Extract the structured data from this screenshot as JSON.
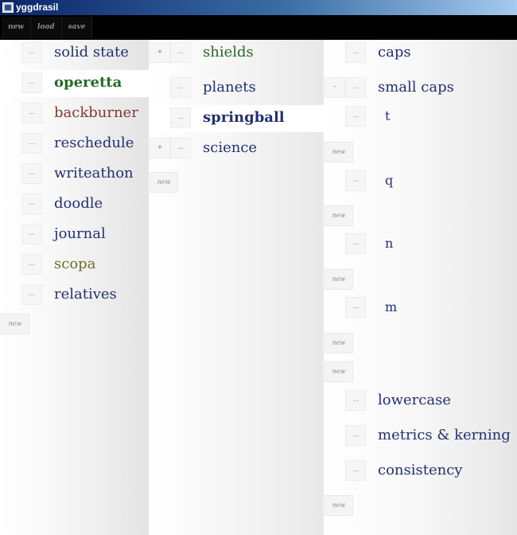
{
  "window": {
    "title": "yggdrasil"
  },
  "toolbar": {
    "new_label": "new",
    "load_label": "load",
    "save_label": "save"
  },
  "colors": {
    "default_text": "#25306d",
    "green_text": "#2a6a2a",
    "brown_text": "#7a3b2e",
    "olive_text": "#6e6e2c",
    "title_gradient_start": "#0a246a",
    "title_gradient_end": "#a6caf0"
  },
  "column1": {
    "items": [
      {
        "label": "solid state",
        "more": "...",
        "color": "#25306d"
      },
      {
        "label": "operetta",
        "more": "...",
        "color": "#2a6a2a"
      },
      {
        "label": "backburner",
        "more": "...",
        "color": "#7a3b2e"
      },
      {
        "label": "reschedule",
        "more": "...",
        "color": "#25306d"
      },
      {
        "label": "writeathon",
        "more": "...",
        "color": "#25306d"
      },
      {
        "label": "doodle",
        "more": "...",
        "color": "#25306d"
      },
      {
        "label": "journal",
        "more": "...",
        "color": "#25306d"
      },
      {
        "label": "scopa",
        "more": "...",
        "color": "#6e6e2c"
      },
      {
        "label": "relatives",
        "more": "...",
        "color": "#25306d"
      }
    ],
    "new_label": "new"
  },
  "column2": {
    "items": [
      {
        "label": "shields",
        "more": "...",
        "toggle": "+",
        "color": "#2a6a2a"
      },
      {
        "label": "planets",
        "more": "...",
        "toggle": "",
        "color": "#25306d"
      },
      {
        "label": "springball",
        "more": "...",
        "toggle": "",
        "color": "#25306d"
      },
      {
        "label": "science",
        "more": "...",
        "toggle": "+",
        "color": "#25306d"
      }
    ],
    "new_label": "new"
  },
  "column3": {
    "items": [
      {
        "label": "caps",
        "more": "...",
        "toggle": ""
      },
      {
        "label": "small caps",
        "more": "...",
        "toggle": "-"
      },
      {
        "label": "t",
        "more": "..."
      },
      {
        "label": "new"
      },
      {
        "label": "q",
        "more": "..."
      },
      {
        "label": "new"
      },
      {
        "label": "n",
        "more": "..."
      },
      {
        "label": "new"
      },
      {
        "label": "m",
        "more": "..."
      },
      {
        "label": "new"
      },
      {
        "label": "new"
      },
      {
        "label": "lowercase",
        "more": "..."
      },
      {
        "label": "metrics & kerning",
        "more": "..."
      },
      {
        "label": "consistency",
        "more": "..."
      },
      {
        "label": "new"
      }
    ]
  }
}
